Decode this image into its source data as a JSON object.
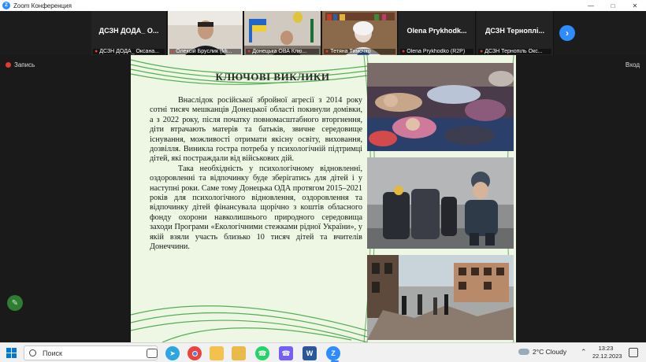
{
  "window": {
    "title": "Zoom Конференция",
    "app_icon": "zoom-logo-icon",
    "controls": [
      "minimize-icon",
      "maximize-icon",
      "close-icon"
    ]
  },
  "participants": [
    {
      "name": "ДСЗН ДОДА_ О...",
      "label": "ДСЗН ДОДА_ Оксана...",
      "video": false
    },
    {
      "name": "",
      "label": "Олексій Бруслик (Мі...",
      "video": true
    },
    {
      "name": "",
      "label": "Донецька ОВА Клю...",
      "video": true
    },
    {
      "name": "",
      "label": "Тетяна Тимочко",
      "video": true
    },
    {
      "name": "Olena Prykhodk...",
      "label": "Olena Prykhodko (R2P)",
      "video": false
    },
    {
      "name": "ДСЗН Терноплі...",
      "label": "ДСЗН Тернопіль Окс...",
      "video": false
    }
  ],
  "meeting": {
    "recording_label": "Запись",
    "login_label": "Вход"
  },
  "slide": {
    "title": "КЛЮЧОВІ ВИКЛИКИ",
    "paragraphs": [
      "Внаслідок російської збройної агресії з 2014 року сотні тисяч мешканців Донецької області покинули домівки, а з 2022 року, після початку повномасштабного вторгнення, діти втрачають матерів та батьків, звичне середовище існування, можливості отримати якісну освіту, виховання, дозвілля. Виникла гостра потреба у психологічній підтримці дітей, які постраждали від військових дій.",
      "Така необхідність у психологічному відновленні, оздоровленні та відпочинку буде зберігатись для дітей і у наступні роки. Саме тому Донецька ОДА протягом 2015–2021 років для психологічного відновлення, оздоровлення та відпочинку дітей фінансувала щорічно з коштів обласного фонду охорони навколишнього природного середовища заходи Програми «Екологічними стежками рідної України», у якій взяли участь близько 10 тисяч дітей та вчителів Донеччини."
    ]
  },
  "taskbar": {
    "search_label": "Поиск",
    "apps": [
      "task-view-icon",
      "telegram-icon",
      "chrome-icon",
      "file-explorer-icon",
      "folder-icon",
      "whatsapp-icon",
      "viber-icon",
      "word-icon",
      "zoom-icon"
    ],
    "weather": "2°C  Cloudy",
    "language": "ENG",
    "time": "13:23",
    "date": "22.12.2023"
  },
  "colors": {
    "zoom_blue": "#2d8cff",
    "record_red": "#e53935",
    "slide_green": "#3aa33a",
    "taskbar_bg": "#f1f1f1"
  }
}
